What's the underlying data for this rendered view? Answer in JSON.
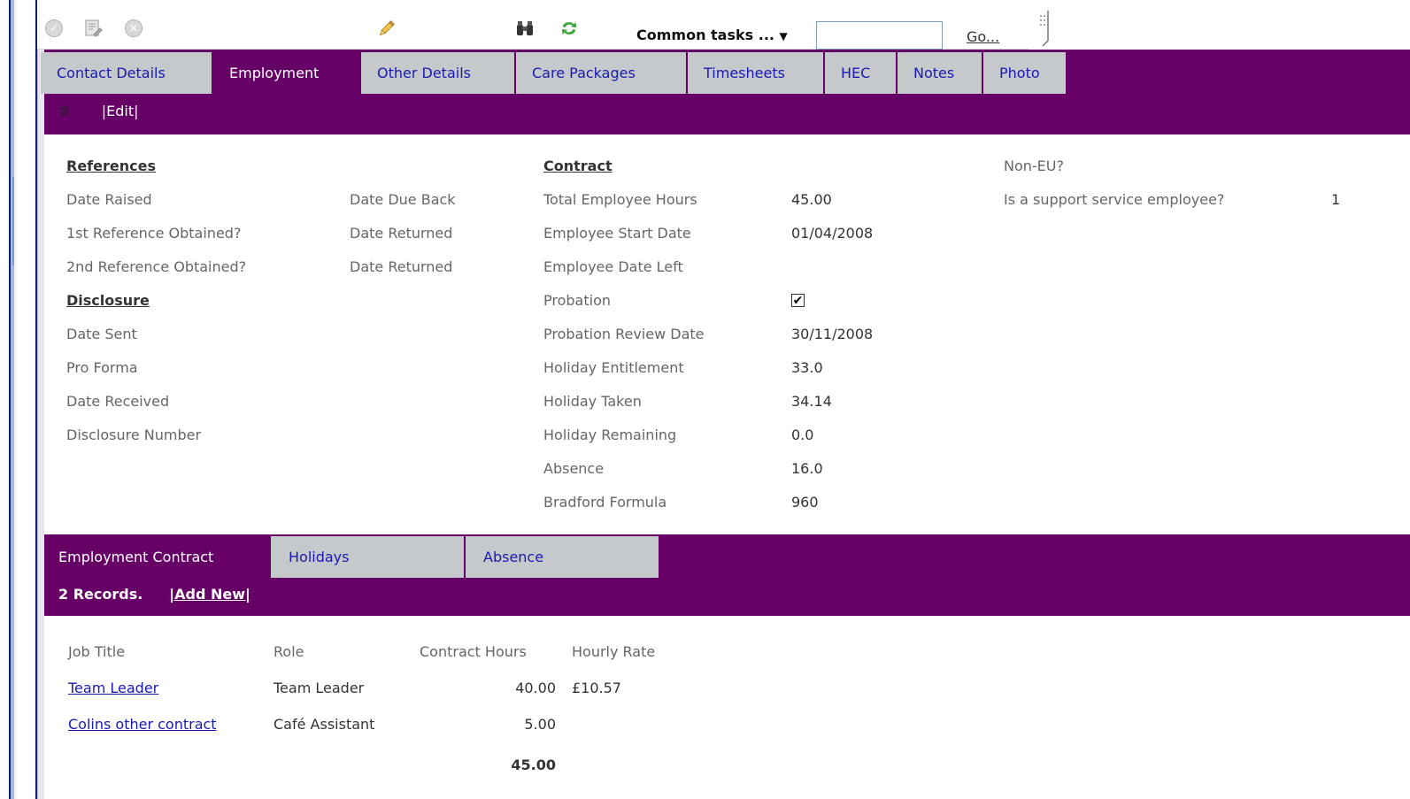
{
  "toolbar": {
    "icons": [
      "check-circle-icon",
      "document-edit-icon",
      "close-circle-icon",
      "pencil-icon",
      "binoculars-icon",
      "refresh-icon"
    ],
    "common_tasks_label": "Common tasks ...",
    "search_value": "",
    "go_label": "Go..."
  },
  "tabs": [
    {
      "label": "Contact Details",
      "active": false
    },
    {
      "label": "Employment",
      "active": true
    },
    {
      "label": "Other Details",
      "active": false
    },
    {
      "label": "Care Packages",
      "active": false
    },
    {
      "label": "Timesheets",
      "active": false
    },
    {
      "label": "HEC",
      "active": false
    },
    {
      "label": "Notes",
      "active": false
    },
    {
      "label": "Photo",
      "active": false
    }
  ],
  "edit_label": "|Edit|",
  "references": {
    "heading": "References",
    "date_raised": "Date Raised",
    "date_due_back": "Date Due Back",
    "first_ref": "1st Reference Obtained?",
    "date_returned_1": "Date Returned",
    "second_ref": "2nd Reference Obtained?",
    "date_returned_2": "Date Returned"
  },
  "disclosure": {
    "heading": "Disclosure",
    "date_sent": "Date Sent",
    "pro_forma": "Pro Forma",
    "date_received": "Date Received",
    "disclosure_number": "Disclosure Number"
  },
  "contract": {
    "heading": "Contract",
    "rows": [
      {
        "label": "Total Employee Hours",
        "value": "45.00"
      },
      {
        "label": "Employee Start Date",
        "value": "01/04/2008"
      },
      {
        "label": "Employee Date Left",
        "value": ""
      },
      {
        "label": "Probation",
        "value": "",
        "checked": true
      },
      {
        "label": "Probation Review Date",
        "value": "30/11/2008"
      },
      {
        "label": "Holiday Entitlement",
        "value": "33.0"
      },
      {
        "label": "Holiday Taken",
        "value": "34.14"
      },
      {
        "label": "Holiday Remaining",
        "value": "0.0"
      },
      {
        "label": "Absence",
        "value": "16.0"
      },
      {
        "label": "Bradford Formula",
        "value": "960"
      }
    ]
  },
  "other": {
    "non_eu_label": "Non-EU?",
    "support_label": "Is a support service employee?",
    "support_value": "1"
  },
  "subtabs": [
    {
      "label": "Employment Contract",
      "active": true
    },
    {
      "label": "Holidays",
      "active": false
    },
    {
      "label": "Absence",
      "active": false
    }
  ],
  "records": {
    "count_label": "2 Records.",
    "add_new_label": "|Add New|"
  },
  "table": {
    "headers": [
      "Job Title",
      "Role",
      "Contract Hours",
      "Hourly Rate"
    ],
    "rows": [
      {
        "job_title": "Team Leader",
        "role": "Team Leader",
        "hours": "40.00",
        "rate": "£10.57"
      },
      {
        "job_title": "Colins other contract",
        "role": "Café Assistant",
        "hours": "5.00",
        "rate": ""
      }
    ],
    "total_hours": "45.00"
  }
}
